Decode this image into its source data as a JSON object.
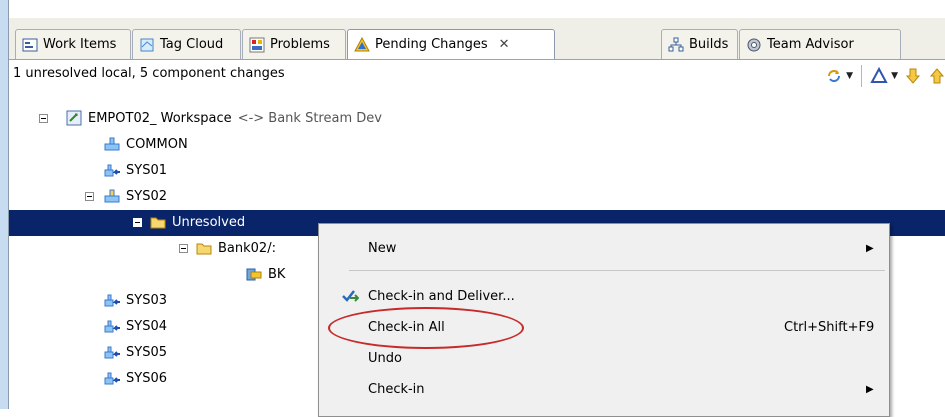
{
  "tabs": [
    {
      "label": "Work Items",
      "icon": "work-items-icon"
    },
    {
      "label": "Tag Cloud",
      "icon": "tag-cloud-icon"
    },
    {
      "label": "Problems",
      "icon": "problems-icon"
    },
    {
      "label": "Pending Changes",
      "icon": "pending-changes-icon",
      "active": true
    },
    {
      "label": "Builds",
      "icon": "builds-icon"
    },
    {
      "label": "Team Advisor",
      "icon": "team-advisor-icon"
    }
  ],
  "tab_close_glyph": "✕",
  "status": "1 unresolved local, 5 component changes",
  "tree": {
    "workspace_name": "EMPOT02_ Workspace",
    "workspace_flow": "<-> Bank Stream Dev",
    "common": "COMMON",
    "sys01": "SYS01",
    "sys02": "SYS02",
    "unresolved": "Unresolved",
    "bank02": "Bank02/:",
    "bk": "BK",
    "sys03": "SYS03",
    "sys04": "SYS04",
    "sys05": "SYS05",
    "sys06": "SYS06"
  },
  "menu": {
    "new": "New",
    "checkin_deliver": "Check-in and Deliver...",
    "checkin_all": "Check-in All",
    "checkin_all_shortcut": "Ctrl+Shift+F9",
    "undo": "Undo",
    "checkin": "Check-in",
    "submenu_arrow": "▶"
  },
  "colors": {
    "selection": "#0a246a",
    "highlight_ellipse": "#c62a2a",
    "tab_bar": "#f0efe7"
  }
}
